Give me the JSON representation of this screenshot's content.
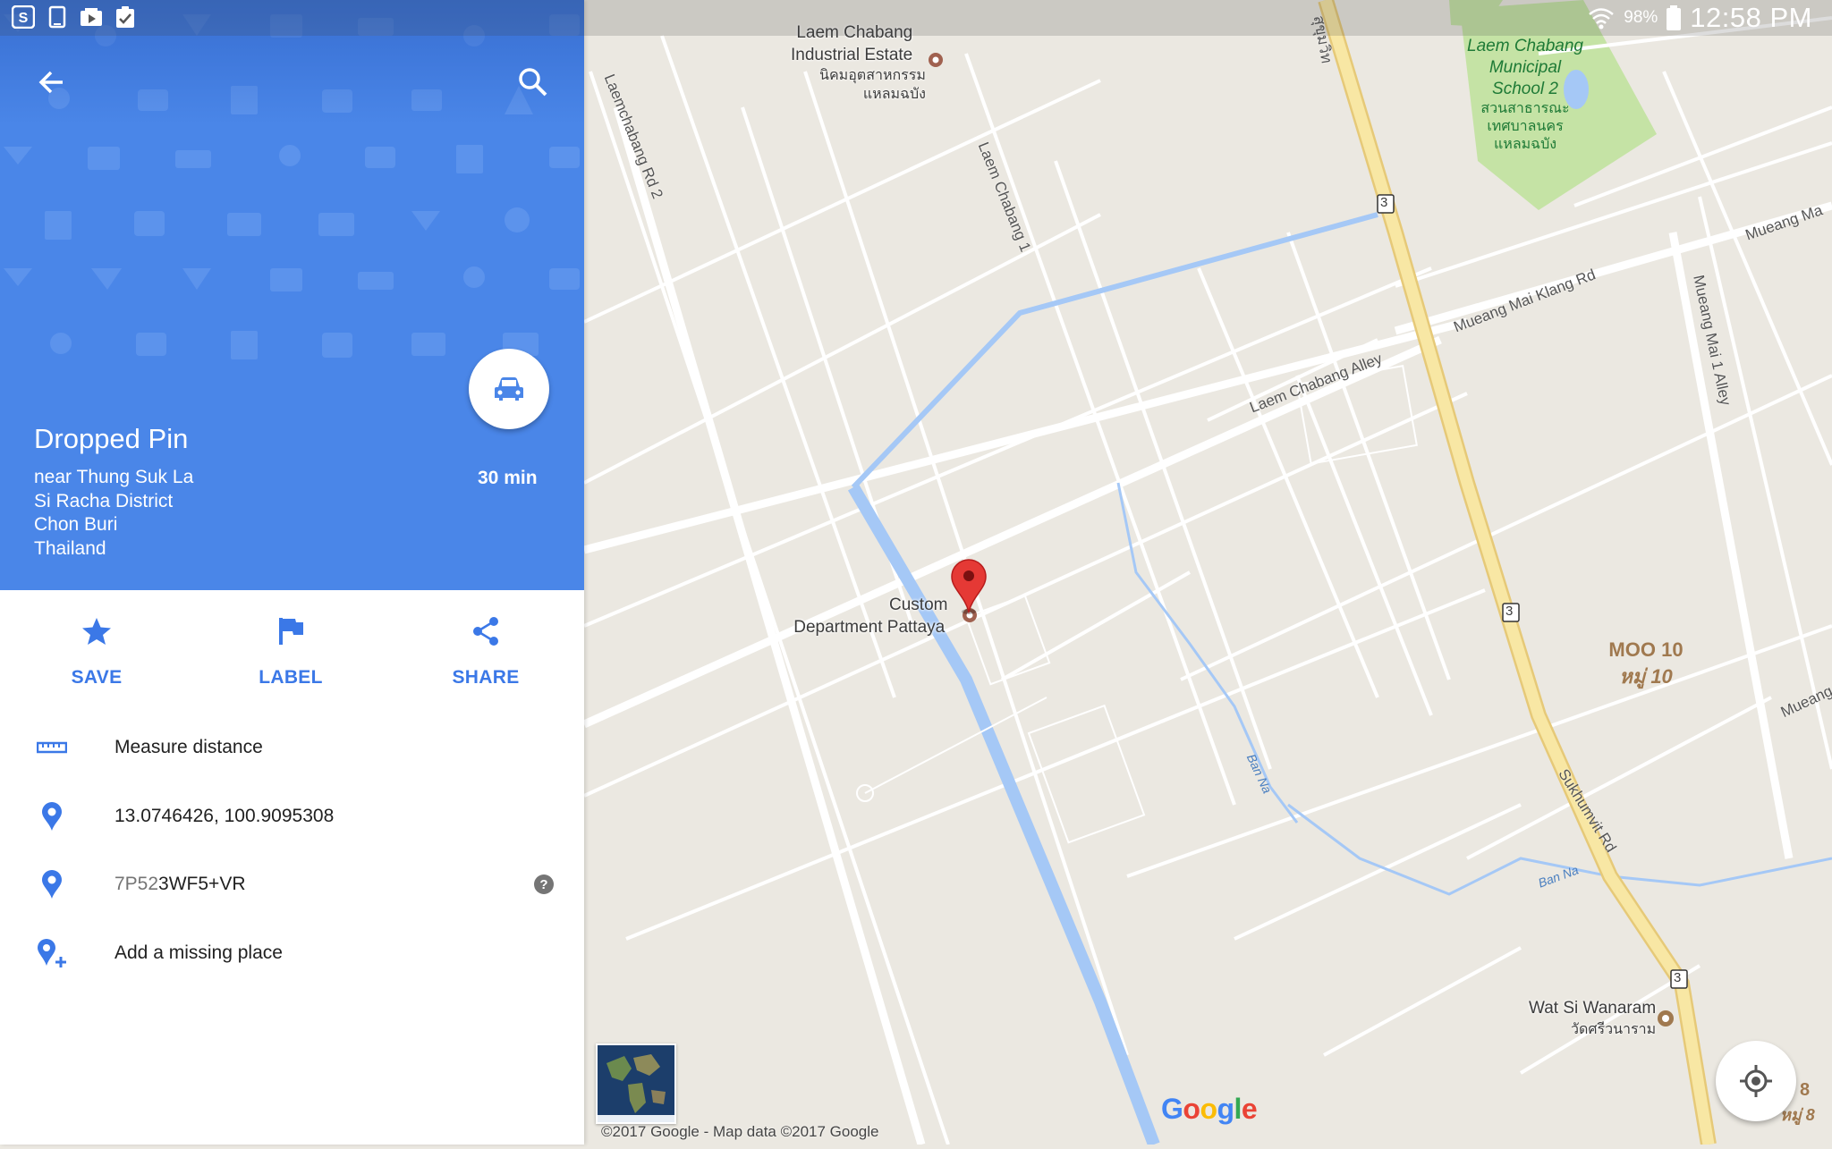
{
  "status_bar": {
    "left_icons": [
      "s-app-icon",
      "tablet-icon",
      "video-icon",
      "clipboard-check-icon"
    ],
    "battery_percent": "98%",
    "time": "12:58 PM"
  },
  "place": {
    "title": "Dropped Pin",
    "address_lines": [
      "near Thung Suk La",
      "Si Racha District",
      "Chon Buri",
      "Thailand"
    ],
    "travel_time": "30 min",
    "travel_mode_icon": "car-icon"
  },
  "actions": [
    {
      "label": "SAVE",
      "icon": "star-icon"
    },
    {
      "label": "LABEL",
      "icon": "flag-icon"
    },
    {
      "label": "SHARE",
      "icon": "share-icon"
    }
  ],
  "details": {
    "measure": "Measure distance",
    "coordinates": "13.0746426, 100.9095308",
    "plus_code_prefix": "7P52",
    "plus_code": "3WF5+VR",
    "add_place": "Add a missing place"
  },
  "map": {
    "pin_label_1": "Custom",
    "pin_label_2": "Department Pattaya",
    "industrial_1": "Laem Chabang",
    "industrial_2": "Industrial Estate",
    "industrial_thai_1": "นิคมอุตสาหกรรม",
    "industrial_thai_2": "แหลมฉบัง",
    "school_lines": [
      "Laem Chabang",
      "Municipal",
      "School 2",
      "สวนสาธารณะ",
      "เทศบาลนคร",
      "แหลมฉบัง"
    ],
    "moo": "MOO 10",
    "moo_thai": "หมู่ 10",
    "wat": "Wat Si Wanaram",
    "wat_thai": "วัดศรีวนาราม",
    "roads": {
      "laemchabang2": "Laemchabang Rd 2",
      "laemchabang1": "Laem Chabang 1",
      "laem_alley": "Laem Chabang Alley",
      "mueang_mai_klang": "Mueang Mai Klang Rd",
      "mueang_ma": "Mueang Ma",
      "mueang_mai_alley": "Mueang Mai 1 Alley",
      "sukhumvit": "Sukhumvit Rd",
      "top_thai": "สุขุมวิท",
      "mueang_right": "Mueang"
    },
    "water": {
      "ban_na_1": "Ban Na",
      "ban_na_2": "Ban Na"
    },
    "route_marker": "3",
    "edge_number_1": "8",
    "edge_number_2": "หมู่ 8",
    "copyright": "©2017 Google - Map data ©2017 Google",
    "google_logo": "Google"
  },
  "colors": {
    "primary_blue": "#4a86e8",
    "action_blue": "#3b78e7",
    "map_background": "#ebe8e1",
    "major_road": "#f8e7a4",
    "water": "#a5c8f6",
    "park": "#c5e3a5",
    "pin_red": "#e53935"
  }
}
